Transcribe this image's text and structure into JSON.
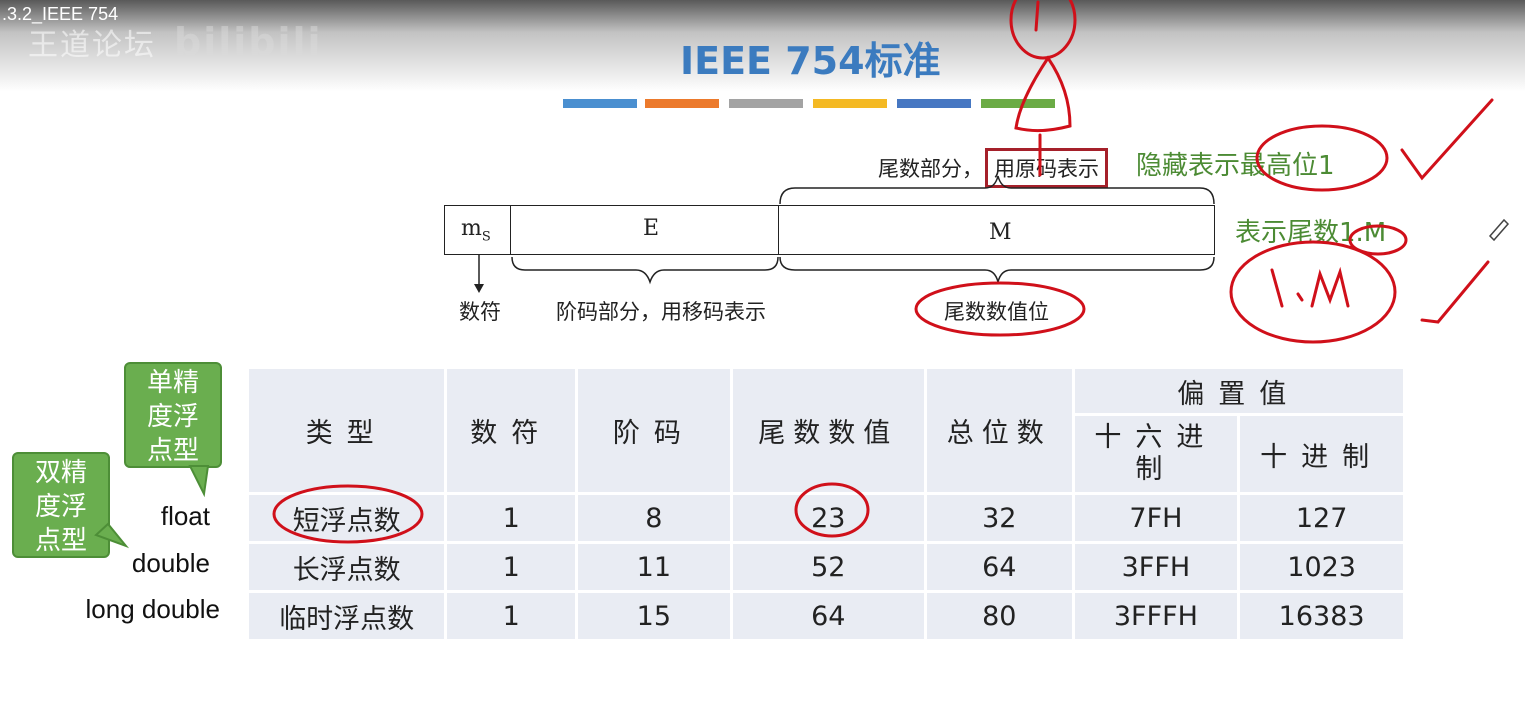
{
  "video": {
    "title": ".3.2_IEEE 754",
    "watermark": "王道论坛",
    "logo": "bilibili"
  },
  "slide": {
    "title": "IEEE 754标准",
    "accent_colors": [
      "#4a8fd0",
      "#ec7a2c",
      "#a3a3a3",
      "#f4b923",
      "#4677c2",
      "#6bab45"
    ]
  },
  "format_diagram": {
    "fields": {
      "sign": "m",
      "sign_sub": "S",
      "exponent": "E",
      "mantissa": "M"
    },
    "label_sign": "数符",
    "label_exponent": "阶码部分，用移码表示",
    "label_mantissa": "尾数数值位",
    "mantissa_note_prefix": "尾数部分，",
    "mantissa_note_boxed": "用原码表示",
    "note_hidden_bit": "隐藏表示最高位1",
    "note_represent": "表示尾数1.M",
    "handwriting": {
      "top_mark": "1",
      "circle_mark": "1.M"
    }
  },
  "callouts": {
    "single": "单精度浮点型",
    "double": "双精度浮点型"
  },
  "row_labels": [
    "float",
    "double",
    "long double"
  ],
  "table": {
    "headers": {
      "type": "类型",
      "sign": "数符",
      "exponent": "阶码",
      "mantissa": "尾数数值",
      "total": "总位数",
      "bias": "偏置值",
      "bias_hex": "十六进制",
      "bias_dec": "十进制"
    },
    "rows": [
      {
        "type": "短浮点数",
        "sign": "1",
        "exponent": "8",
        "mantissa": "23",
        "total": "32",
        "bias_hex": "7FH",
        "bias_dec": "127"
      },
      {
        "type": "长浮点数",
        "sign": "1",
        "exponent": "11",
        "mantissa": "52",
        "total": "64",
        "bias_hex": "3FFH",
        "bias_dec": "1023"
      },
      {
        "type": "临时浮点数",
        "sign": "1",
        "exponent": "15",
        "mantissa": "64",
        "total": "80",
        "bias_hex": "3FFFH",
        "bias_dec": "16383"
      }
    ]
  },
  "annotation_color": "#d0101a"
}
